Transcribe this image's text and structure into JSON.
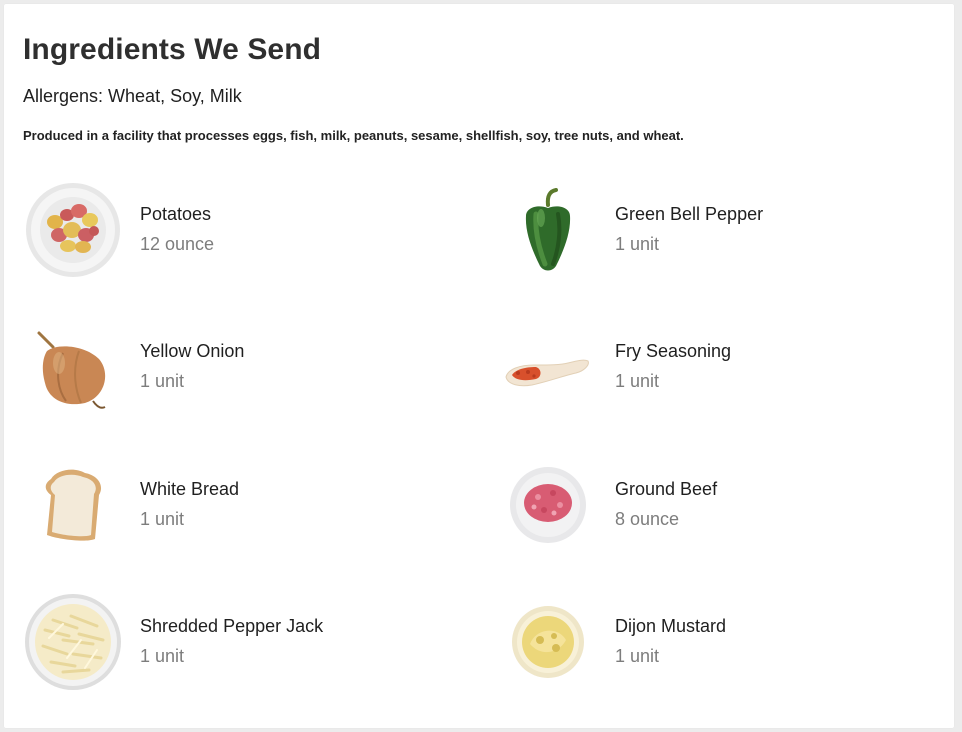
{
  "section": {
    "title": "Ingredients We Send",
    "allergens": "Allergens: Wheat, Soy, Milk",
    "facility_note": "Produced in a facility that processes eggs, fish, milk, peanuts, sesame, shellfish, soy, tree nuts, and wheat."
  },
  "ingredients": [
    {
      "name": "Potatoes",
      "amount": "12 ounce",
      "icon": "potatoes-icon"
    },
    {
      "name": "Green Bell Pepper",
      "amount": "1 unit",
      "icon": "green-bell-pepper-icon"
    },
    {
      "name": "Yellow Onion",
      "amount": "1 unit",
      "icon": "yellow-onion-icon"
    },
    {
      "name": "Fry Seasoning",
      "amount": "1 unit",
      "icon": "fry-seasoning-icon"
    },
    {
      "name": "White Bread",
      "amount": "1 unit",
      "icon": "white-bread-icon"
    },
    {
      "name": "Ground Beef",
      "amount": "8 ounce",
      "icon": "ground-beef-icon"
    },
    {
      "name": "Shredded Pepper Jack",
      "amount": "1 unit",
      "icon": "shredded-pepper-jack-icon"
    },
    {
      "name": "Dijon Mustard",
      "amount": "1 unit",
      "icon": "dijon-mustard-icon"
    }
  ]
}
